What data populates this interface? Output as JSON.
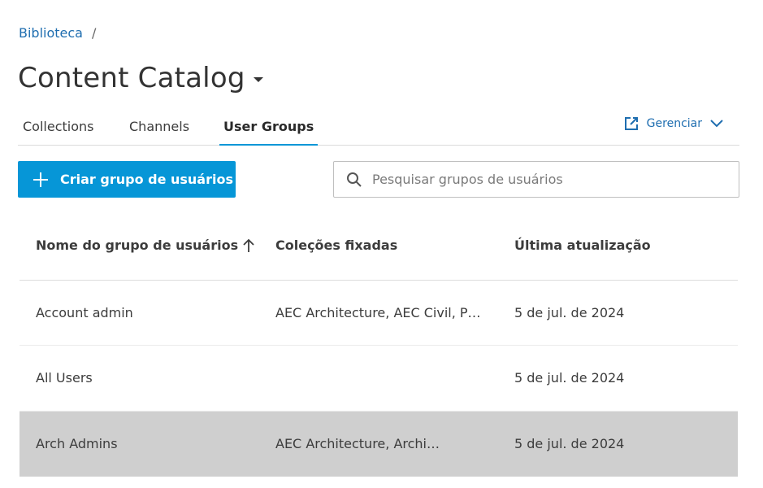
{
  "breadcrumb": {
    "link": "Biblioteca",
    "separator": "/"
  },
  "page_title": "Content Catalog",
  "tabs": [
    {
      "label": "Collections",
      "active": false
    },
    {
      "label": "Channels",
      "active": false
    },
    {
      "label": "User Groups",
      "active": true
    }
  ],
  "manage": {
    "label": "Gerenciar",
    "icon": "external-link-icon"
  },
  "toolbar": {
    "create_label": "Criar grupo de usuários"
  },
  "search": {
    "placeholder": "Pesquisar grupos de usuários",
    "value": ""
  },
  "table": {
    "columns": [
      "Nome do grupo de usuários",
      "Coleções fixadas",
      "Última atualização"
    ],
    "sort": {
      "column": 0,
      "direction": "ascending"
    },
    "rows": [
      {
        "name": "Account admin",
        "collections": "AEC Architecture, AEC Civil, P…",
        "updated": "5 de jul. de 2024",
        "selected": false
      },
      {
        "name": "All Users",
        "collections": "",
        "updated": "5 de jul. de 2024",
        "selected": false
      },
      {
        "name": "Arch Admins",
        "collections": "AEC Architecture, Archi…",
        "updated": "5 de jul. de 2024",
        "selected": true
      }
    ]
  },
  "colors": {
    "accent": "#0696d7",
    "link": "#1f6eb0",
    "selected_row": "#cfcfcf"
  }
}
